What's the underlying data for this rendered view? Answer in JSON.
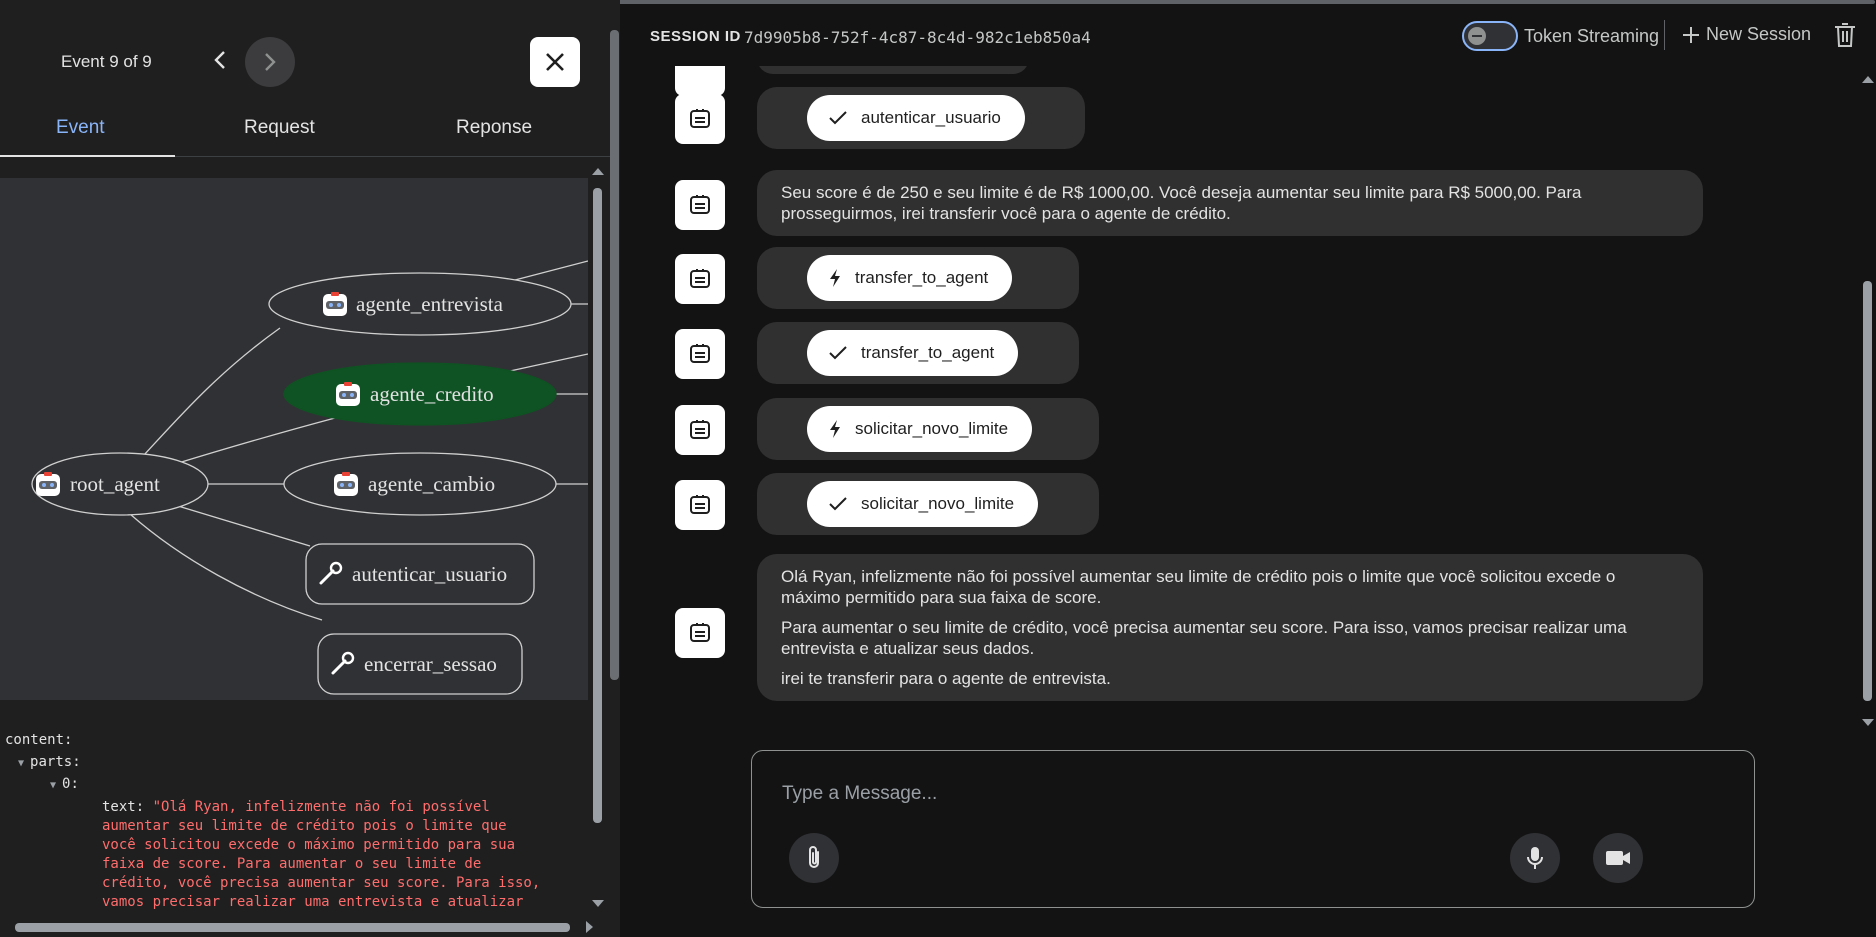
{
  "event_panel": {
    "counter": "Event 9 of 9",
    "tabs": [
      {
        "label": "Event",
        "active": true
      },
      {
        "label": "Request",
        "active": false
      },
      {
        "label": "Reponse",
        "active": false
      }
    ]
  },
  "graph": {
    "nodes": {
      "root": "root_agent",
      "entrevista": "agente_entrevista",
      "credito": "agente_credito",
      "cambio": "agente_cambio",
      "autenticar": "autenticar_usuario",
      "encerrar": "encerrar_sessao"
    },
    "highlight_color": "#0f5223"
  },
  "event_json": {
    "content_key": "content:",
    "parts_key": "parts:",
    "index_key": "0:",
    "text_key": "text:",
    "text_lines": [
      "\"Olá Ryan, infelizmente não foi possível",
      "aumentar seu limite de crédito pois o limite que",
      "você solicitou excede o máximo permitido para sua",
      "faixa de score. Para aumentar o seu limite de",
      "crédito, você precisa aumentar seu score. Para isso,",
      "vamos precisar realizar uma entrevista e atualizar"
    ]
  },
  "session": {
    "label": "SESSION ID",
    "id": "7d9905b8-752f-4c87-8c4d-982c1eb850a4",
    "token_streaming_label": "Token Streaming",
    "new_session_label": "New Session"
  },
  "messages": {
    "m1": {
      "type": "tool-response",
      "label": "autenticar_usuario"
    },
    "m2": {
      "type": "text",
      "paragraphs": [
        "Seu score é de 250 e seu limite é de R$ 1000,00. Você deseja aumentar seu limite para R$ 5000,00. Para prosseguirmos, irei transferir você para o agente de crédito."
      ]
    },
    "m3": {
      "type": "tool-call",
      "label": "transfer_to_agent"
    },
    "m4": {
      "type": "tool-response",
      "label": "transfer_to_agent"
    },
    "m5": {
      "type": "tool-call",
      "label": "solicitar_novo_limite"
    },
    "m6": {
      "type": "tool-response",
      "label": "solicitar_novo_limite"
    },
    "m7": {
      "type": "text",
      "paragraphs": [
        "Olá Ryan, infelizmente não foi possível aumentar seu limite de crédito pois o limite que você solicitou excede o máximo permitido para sua faixa de score.",
        "Para aumentar o seu limite de crédito, você precisa aumentar seu score. Para isso, vamos precisar realizar uma entrevista e atualizar seus dados.",
        "irei te transferir para o agente de entrevista."
      ]
    }
  },
  "composer": {
    "placeholder": "Type a Message..."
  },
  "icons": {
    "check": "check-icon",
    "bolt": "bolt-icon",
    "bot": "bot-icon",
    "attach": "paperclip-icon",
    "mic": "mic-icon",
    "video": "video-icon"
  }
}
